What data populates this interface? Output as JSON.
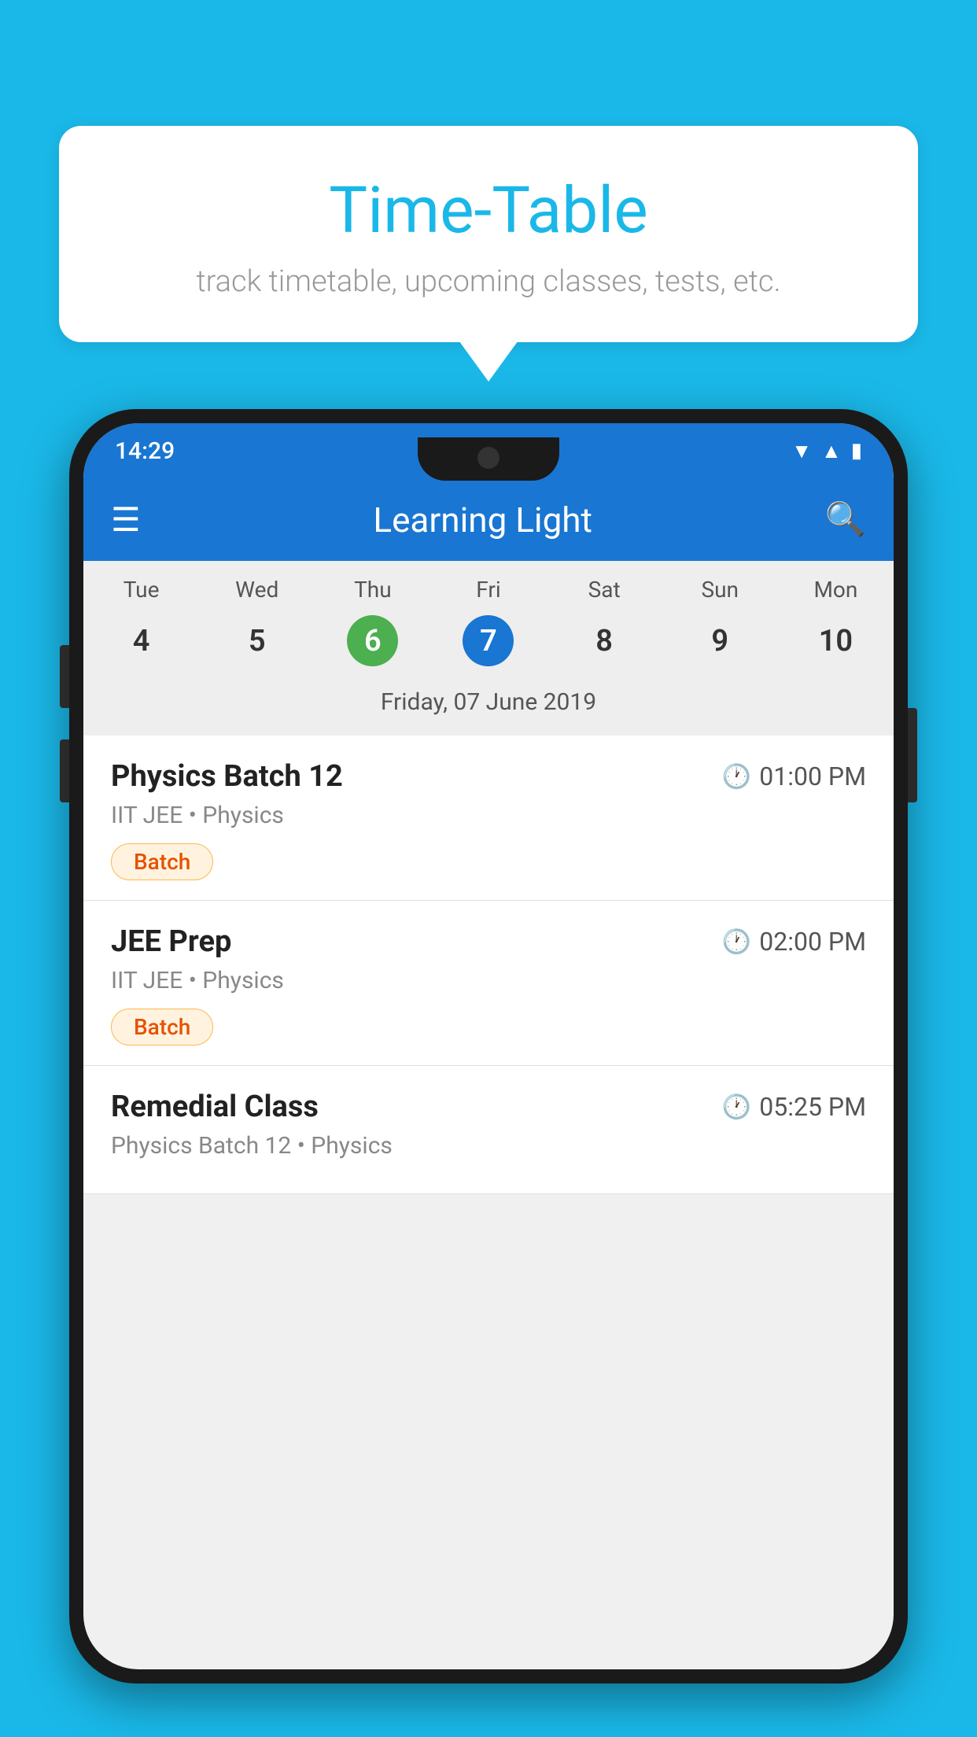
{
  "background_color": "#1ab8e8",
  "bubble": {
    "title": "Time-Table",
    "subtitle": "track timetable, upcoming classes, tests, etc."
  },
  "status_bar": {
    "time": "14:29"
  },
  "app_bar": {
    "title": "Learning Light",
    "hamburger_label": "☰",
    "search_label": "🔍"
  },
  "calendar": {
    "days": [
      {
        "label": "Tue",
        "num": "4"
      },
      {
        "label": "Wed",
        "num": "5"
      },
      {
        "label": "Thu",
        "num": "6",
        "state": "today"
      },
      {
        "label": "Fri",
        "num": "7",
        "state": "selected"
      },
      {
        "label": "Sat",
        "num": "8"
      },
      {
        "label": "Sun",
        "num": "9"
      },
      {
        "label": "Mon",
        "num": "10"
      }
    ],
    "selected_date_label": "Friday, 07 June 2019"
  },
  "schedule": [
    {
      "title": "Physics Batch 12",
      "time": "01:00 PM",
      "subtitle": "IIT JEE • Physics",
      "badge": "Batch"
    },
    {
      "title": "JEE Prep",
      "time": "02:00 PM",
      "subtitle": "IIT JEE • Physics",
      "badge": "Batch"
    },
    {
      "title": "Remedial Class",
      "time": "05:25 PM",
      "subtitle": "Physics Batch 12 • Physics",
      "badge": ""
    }
  ]
}
